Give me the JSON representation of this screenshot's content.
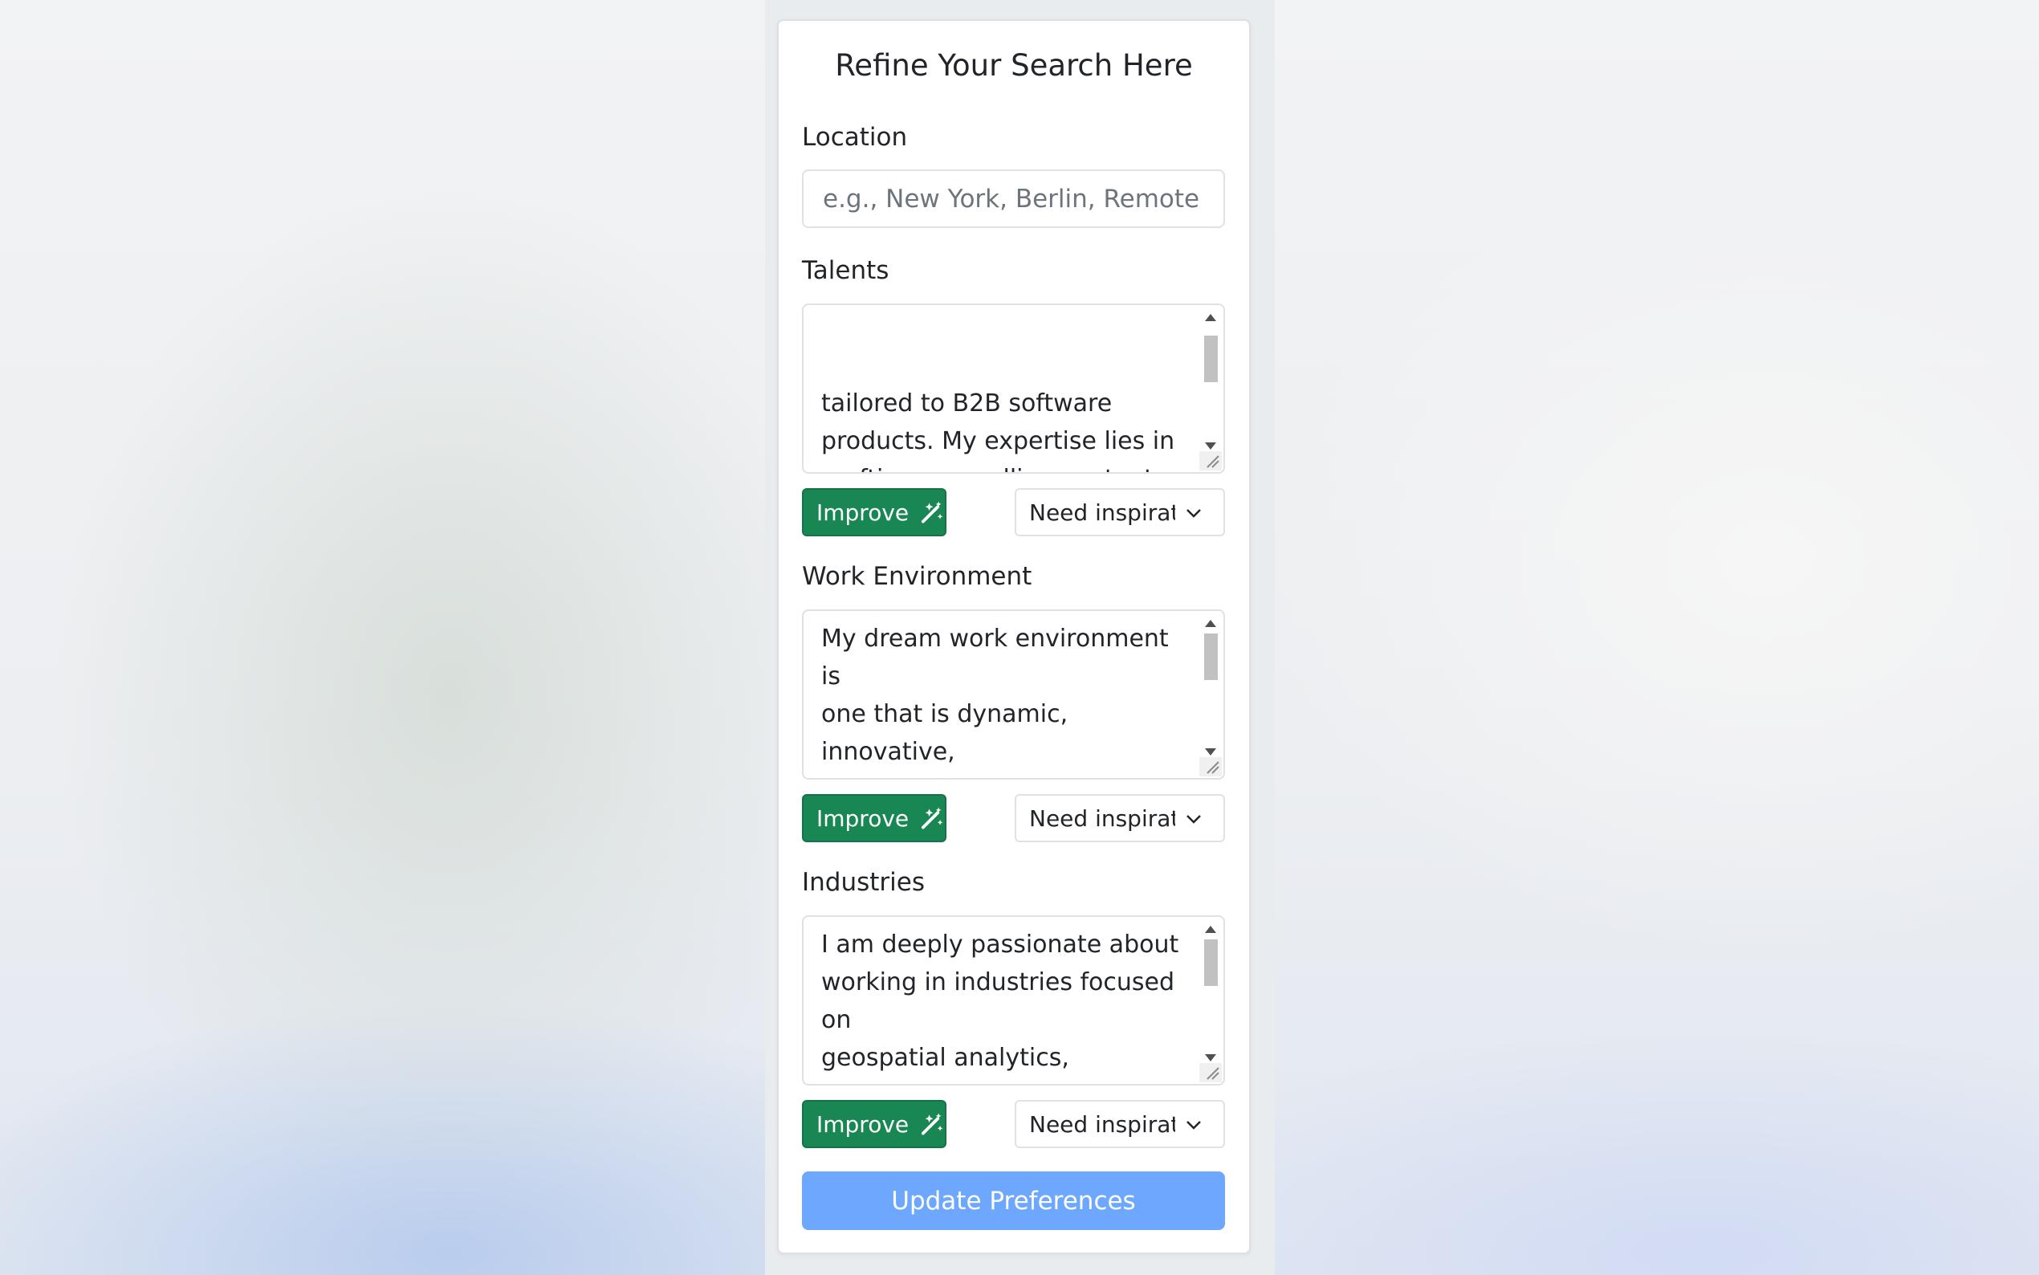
{
  "form": {
    "title": "Refine Your Search Here",
    "location": {
      "label": "Location",
      "placeholder": "e.g., New York, Berlin, Remote",
      "value": ""
    },
    "talents": {
      "label": "Talents",
      "text": "tailored to B2B software\nproducts. My expertise lies in\ncrafting compelling content and\nmessaging that resonates with",
      "improve_label": "Improve",
      "select_label": "Need inspiration"
    },
    "work_environment": {
      "label": "Work Environment",
      "text": "My dream work environment is\none that is dynamic, innovative,\nand mission-driven, with a\nstrong focus on sustainability",
      "improve_label": "Improve",
      "select_label": "Need inspiration"
    },
    "industries": {
      "label": "Industries",
      "text": "I am deeply passionate about\nworking in industries focused on\ngeospatial analytics,\nenvironmental sustainability,",
      "improve_label": "Improve",
      "select_label": "Need inspiration"
    },
    "submit_label": "Update Preferences"
  },
  "icons": {
    "improve": "magic-wand-icon",
    "select": "chevron-down-icon"
  },
  "colors": {
    "improve_button": "#198754",
    "submit_button": "#6ea8fe",
    "card_background": "#ffffff",
    "column_background": "#e9ecef"
  }
}
